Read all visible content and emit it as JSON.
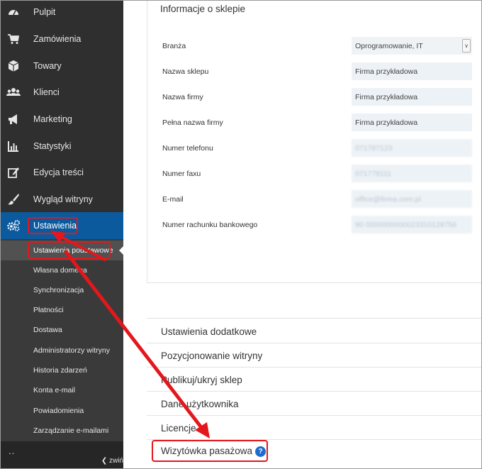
{
  "sidebar": {
    "items": [
      {
        "label": "Pulpit",
        "icon": "dashboard-icon"
      },
      {
        "label": "Zamówienia",
        "icon": "cart-icon"
      },
      {
        "label": "Towary",
        "icon": "box-icon"
      },
      {
        "label": "Klienci",
        "icon": "users-icon"
      },
      {
        "label": "Marketing",
        "icon": "megaphone-icon"
      },
      {
        "label": "Statystyki",
        "icon": "bar-chart-icon"
      },
      {
        "label": "Edycja treści",
        "icon": "edit-icon"
      },
      {
        "label": "Wygląd witryny",
        "icon": "brush-icon"
      },
      {
        "label": "Ustawienia",
        "icon": "gears-icon"
      }
    ],
    "sub_items": [
      {
        "label": "Ustawienia podstawowe"
      },
      {
        "label": "Własna domena"
      },
      {
        "label": "Synchronizacja"
      },
      {
        "label": "Płatności"
      },
      {
        "label": "Dostawa"
      },
      {
        "label": "Administratorzy witryny"
      },
      {
        "label": "Historia zdarzeń"
      },
      {
        "label": "Konta e-mail"
      },
      {
        "label": "Powiadomienia"
      },
      {
        "label": "Zarządzanie e-mailami"
      }
    ],
    "bottom": {
      "dots": "..",
      "collapse_label": "zwiń"
    }
  },
  "store_info": {
    "title": "Informacje o sklepie",
    "rows": [
      {
        "label": "Branża",
        "value": "Oprogramowanie, IT"
      },
      {
        "label": "Nazwa sklepu",
        "value": "Firma przykładowa"
      },
      {
        "label": "Nazwa firmy",
        "value": "Firma przykładowa"
      },
      {
        "label": "Pełna nazwa firmy",
        "value": "Firma przykładowa"
      },
      {
        "label": "Numer telefonu",
        "value": "071787123"
      },
      {
        "label": "Numer faxu",
        "value": "071778111"
      },
      {
        "label": "E-mail",
        "value": "office@firma.com.pl"
      },
      {
        "label": "Numer rachunku bankowego",
        "value": "90 0000000000023310128756"
      }
    ]
  },
  "sections": [
    {
      "label": "Ustawienia dodatkowe"
    },
    {
      "label": "Pozycjonowanie witryny"
    },
    {
      "label": "Publikuj/ukryj sklep"
    },
    {
      "label": "Dane użytkownika"
    },
    {
      "label": "Licencje"
    },
    {
      "label": "Wizytówka pasażowa"
    }
  ],
  "colors": {
    "sidebar_bg": "#2f2f2f",
    "active_bg": "#0c5a9e",
    "highlight": "#e3171c",
    "field_bg": "#edf2f6",
    "help_icon": "#1e6bd0"
  }
}
